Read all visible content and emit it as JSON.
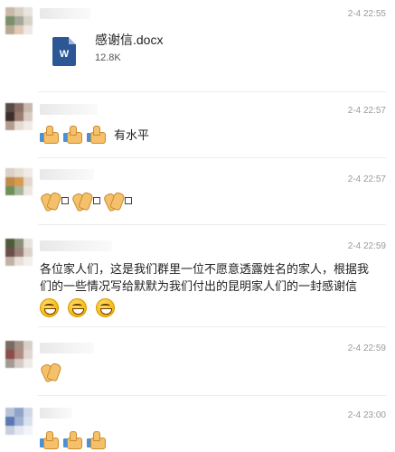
{
  "messages": [
    {
      "time": "2-4 22:55",
      "file": {
        "name": "感谢信.docx",
        "size": "12.8K",
        "icon_letter": "W"
      }
    },
    {
      "time": "2-4 22:57",
      "emojis": [
        "thumbs-up",
        "thumbs-up",
        "thumbs-up"
      ],
      "text": "有水平"
    },
    {
      "time": "2-4 22:57",
      "emojis": [
        "clapping-hands",
        "clapping-hands",
        "clapping-hands"
      ]
    },
    {
      "time": "2-4 22:59",
      "text_line1": "各位家人们，这是我们群里一位不愿意透露姓名的家人，根据我",
      "text_line2": "们的一些情况写给默默为我们付出的昆明家人们的一封感谢信",
      "emojis": [
        "grinning-face",
        "grinning-face",
        "grinning-face"
      ]
    },
    {
      "time": "2-4 22:59",
      "emojis": [
        "clapping-hands"
      ]
    },
    {
      "time": "2-4 23:00",
      "emojis": [
        "thumbs-up",
        "thumbs-up",
        "thumbs-up"
      ]
    }
  ],
  "colors": {
    "file_icon": "#2b5797",
    "time_text": "#9a9a9a",
    "divider": "#ececec"
  }
}
